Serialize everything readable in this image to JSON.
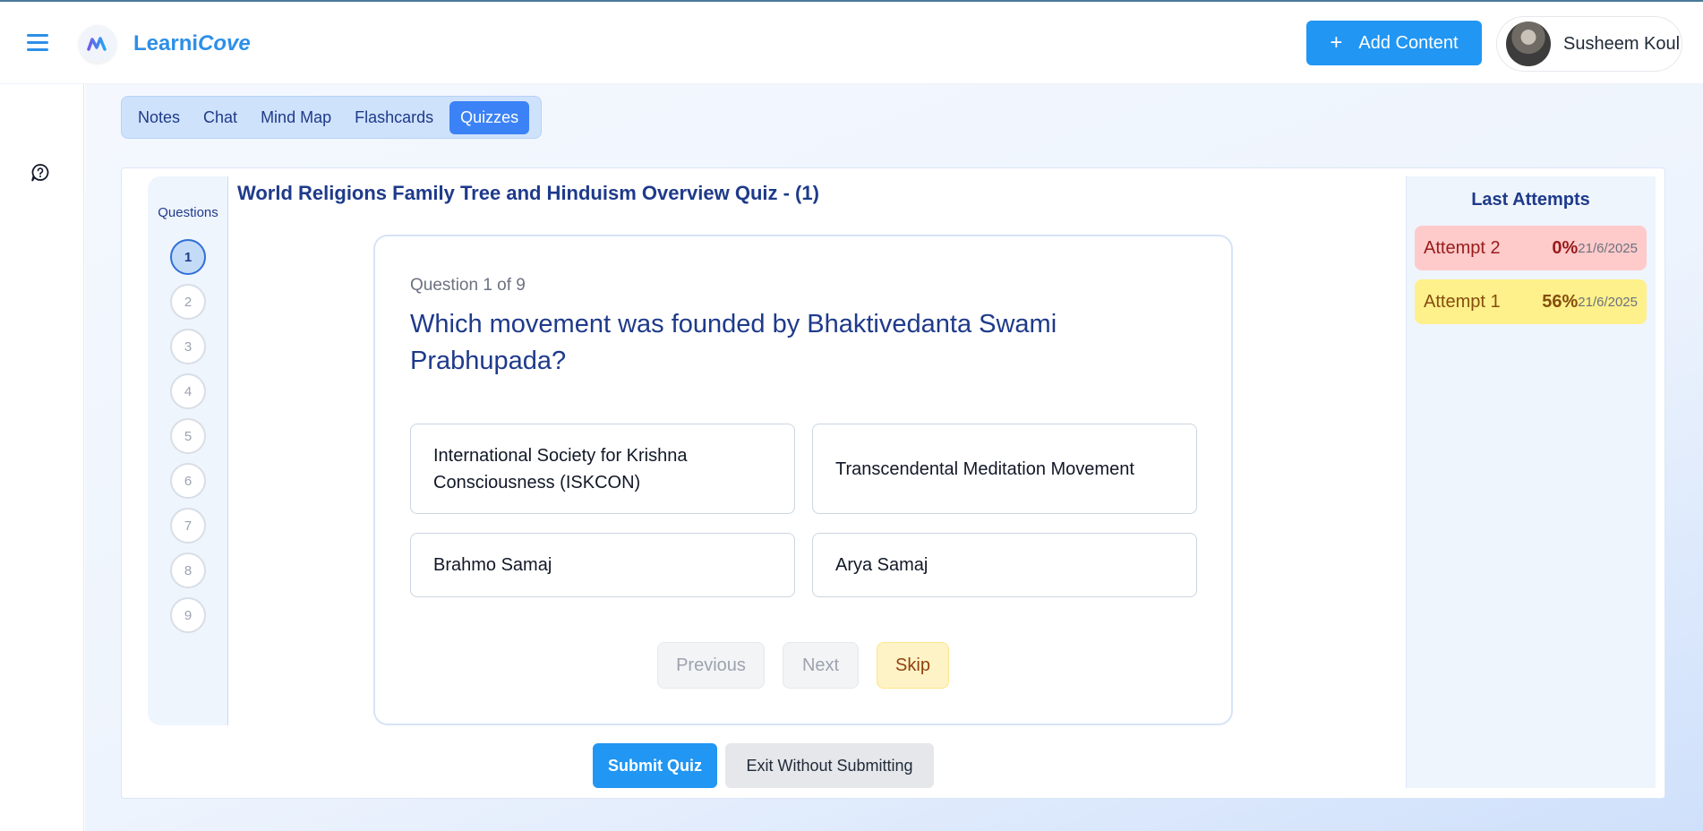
{
  "header": {
    "brand_first": "Learni",
    "brand_second": "Cove",
    "add_content_label": "Add Content",
    "user_name": "Susheem Koul"
  },
  "tabs": [
    "Notes",
    "Chat",
    "Mind Map",
    "Flashcards",
    "Quizzes"
  ],
  "active_tab": "Quizzes",
  "quiz": {
    "title": "World Religions Family Tree and Hinduism Overview Quiz - (1)",
    "questions_label": "Questions",
    "question_numbers": [
      "1",
      "2",
      "3",
      "4",
      "5",
      "6",
      "7",
      "8",
      "9"
    ],
    "current_question": "1",
    "question_count": "Question 1 of 9",
    "question_text": "Which movement was founded by Bhaktivedanta Swami Prabhupada?",
    "options": [
      "International Society for Krishna Consciousness (ISKCON)",
      "Transcendental Meditation Movement",
      "Brahmo Samaj",
      "Arya Samaj"
    ],
    "previous_label": "Previous",
    "next_label": "Next",
    "skip_label": "Skip",
    "submit_label": "Submit Quiz",
    "exit_label": "Exit Without Submitting"
  },
  "attempts": {
    "title": "Last Attempts",
    "items": [
      {
        "name": "Attempt 2",
        "score": "0%",
        "date": "21/6/2025",
        "status_color": "#fecaca"
      },
      {
        "name": "Attempt 1",
        "score": "56%",
        "date": "21/6/2025",
        "status_color": "#fef08a"
      }
    ]
  },
  "colors": {
    "accent": "#2196f3",
    "title": "#1e3a8a"
  }
}
